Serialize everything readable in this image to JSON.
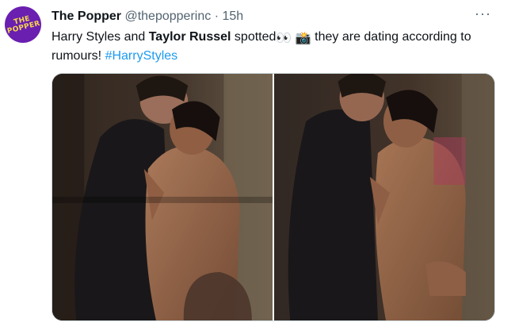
{
  "tweet": {
    "avatar_text": "THE POPPER",
    "display_name": "The Popper",
    "handle": "@thepopperinc",
    "separator": "·",
    "time": "15h",
    "more_label": "···",
    "text_part1": "Harry Styles and ",
    "text_bold": "Taylor Russel",
    "text_part2": " spotted",
    "text_part3": " they are dating according to rumours! ",
    "hashtag": "#HarryStyles",
    "emoji_eyes": "👀",
    "emoji_camera": "📸"
  },
  "media": {
    "photos": [
      "photo-left",
      "photo-right"
    ]
  }
}
